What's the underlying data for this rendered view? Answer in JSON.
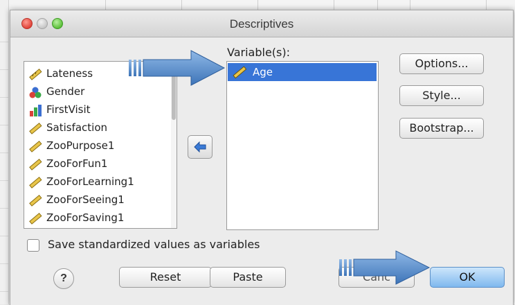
{
  "window": {
    "title": "Descriptives"
  },
  "source_list": {
    "items": [
      {
        "label": "Lateness",
        "icon": "scale-ruler-icon"
      },
      {
        "label": "Gender",
        "icon": "nominal-circles-icon"
      },
      {
        "label": "FirstVisit",
        "icon": "ordinal-bars-icon"
      },
      {
        "label": "Satisfaction",
        "icon": "scale-ruler-icon"
      },
      {
        "label": "ZooPurpose1",
        "icon": "scale-ruler-icon"
      },
      {
        "label": "ZooForFun1",
        "icon": "scale-ruler-icon"
      },
      {
        "label": "ZooForLearning1",
        "icon": "scale-ruler-icon"
      },
      {
        "label": "ZooForSeeing1",
        "icon": "scale-ruler-icon"
      },
      {
        "label": "ZooForSaving1",
        "icon": "scale-ruler-icon"
      }
    ]
  },
  "target": {
    "label": "Variable(s):",
    "items": [
      {
        "label": "Age",
        "icon": "scale-ruler-icon"
      }
    ]
  },
  "side_buttons": {
    "options": "Options...",
    "style": "Style...",
    "bootstrap": "Bootstrap..."
  },
  "checkbox": {
    "label": "Save standardized values as variables",
    "checked": false
  },
  "bottom_buttons": {
    "help": "?",
    "reset": "Reset",
    "paste": "Paste",
    "cancel": "Canc",
    "ok": "OK"
  },
  "colors": {
    "selection": "#3875d7",
    "arrow": "#4a86c6",
    "ok_button": "#7fb8ee"
  }
}
